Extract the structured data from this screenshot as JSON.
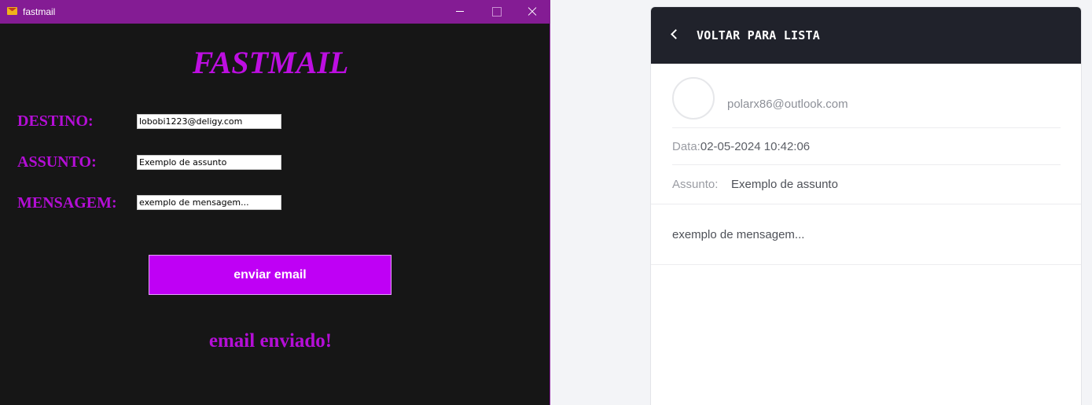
{
  "app": {
    "window_title": "fastmail",
    "heading": "FASTMAIL",
    "fields": {
      "destino_label": "DESTINO:",
      "destino_value": "lobobi1223@deligy.com",
      "assunto_label": "ASSUNTO:",
      "assunto_value": "Exemplo de assunto",
      "mensagem_label": "MENSAGEM:",
      "mensagem_value": "exemplo de mensagem..."
    },
    "send_label": "enviar email",
    "status": "email enviado!",
    "colors": {
      "accent": "#bf00f5",
      "title_bar": "#841c94",
      "background": "#161616"
    }
  },
  "viewer": {
    "back_label": "VOLTAR PARA LISTA",
    "sender": "polarx86@outlook.com",
    "date_label": "Data:",
    "date_value": "02-05-2024 10:42:06",
    "subject_label": "Assunto:",
    "subject_value": "Exemplo de assunto",
    "body": "exemplo de mensagem...",
    "colors": {
      "header_bg": "#20222b"
    }
  }
}
